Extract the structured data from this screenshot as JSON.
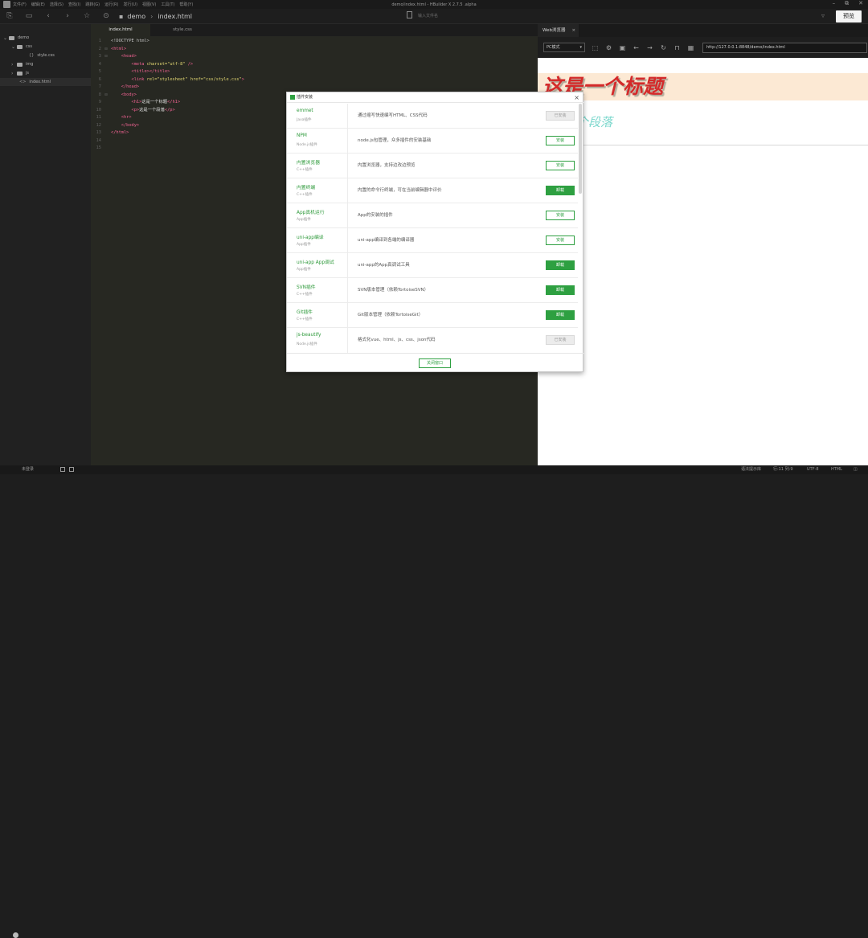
{
  "app": {
    "window_title": "demo/index.html - HBuilder X 2.7.5 .alpha",
    "menu": [
      "文件(F)",
      "编辑(E)",
      "选择(S)",
      "查找(I)",
      "跳转(G)",
      "运行(R)",
      "发行(U)",
      "视图(V)",
      "工具(T)",
      "帮助(Y)"
    ],
    "window_controls": [
      "–",
      "⧉",
      "✕"
    ]
  },
  "toolbar": {
    "breadcrumb": [
      "demo",
      "index.html"
    ],
    "search_placeholder": "输入文件名",
    "preview_label": "预览"
  },
  "sidebar": {
    "items": [
      {
        "label": "demo"
      },
      {
        "label": "css"
      },
      {
        "label": "style.css"
      },
      {
        "label": "img"
      },
      {
        "label": "js"
      },
      {
        "label": "index.html"
      }
    ]
  },
  "editor": {
    "tabs": [
      {
        "label": "index.html"
      },
      {
        "label": "style.css"
      }
    ],
    "line_numbers": [
      "1",
      "2",
      "3",
      "4",
      "5",
      "6",
      "7",
      "8",
      "9",
      "10",
      "11",
      "12",
      "13",
      "14",
      "15"
    ],
    "code": {
      "l1": "<!DOCTYPE html>",
      "l2a": "<html",
      "l2b": ">",
      "l3a": "<head",
      "l3b": ">",
      "l4a": "<meta",
      "l4b": " charset=",
      "l4c": "\"utf-8\"",
      "l4d": " />",
      "l5a": "<title></title>",
      "l6a": "<link",
      "l6b": " rel=",
      "l6c": "\"stylesheet\"",
      "l6d": " href=",
      "l6e": "\"css/style.css\"",
      "l6f": ">",
      "l7": "</head>",
      "l8": "<body>",
      "l9a": "<h1>",
      "l9b": "这是一个标题",
      "l9c": "</h1>",
      "l10a": "<p>",
      "l10b": "这是一个段落",
      "l10c": "</p>",
      "l11": "<hr>",
      "l12": "</body>",
      "l13": "</html>"
    }
  },
  "browser": {
    "tab_label": "Web浏览器",
    "device": "PC模式",
    "url": "http://127.0.0.1:8848/demo/index.html",
    "h1": "这是一个标题",
    "p": "个段落"
  },
  "dialog": {
    "title": "插件安装",
    "close_label": "关闭窗口",
    "plugins": [
      {
        "name": "emmet",
        "type": "Java插件",
        "desc": "通过缩写快速编写HTML、CSS代码",
        "action": "已安装"
      },
      {
        "name": "NPM",
        "type": "Node.js插件",
        "desc": "node.js包管理，众多插件的安装基础",
        "action": "安装"
      },
      {
        "name": "内置浏览器",
        "type": "C++插件",
        "desc": "内置浏览器，支持边改边预览",
        "action": "安装"
      },
      {
        "name": "内置终端",
        "type": "C++插件",
        "desc": "内置的命令行终端，可在当前编辑器中评价",
        "action": "卸载"
      },
      {
        "name": "App真机运行",
        "type": "App插件",
        "desc": "App的安装的插件",
        "action": "安装"
      },
      {
        "name": "uni-app编译",
        "type": "App插件",
        "desc": "uni-app编译到各端的编译器",
        "action": "安装"
      },
      {
        "name": "uni-app App调试",
        "type": "App插件",
        "desc": "uni-app的App真调试工具",
        "action": "卸载"
      },
      {
        "name": "SVN插件",
        "type": "C++插件",
        "desc": "SVN版本管理（依赖TortoiseSVN）",
        "action": "卸载"
      },
      {
        "name": "Git插件",
        "type": "C++插件",
        "desc": "Git版本管理（依赖TortoiseGit）",
        "action": "卸载"
      },
      {
        "name": "js-beautify",
        "type": "Node.js插件",
        "desc": "格式化vue、html、js、css、json代码",
        "action": "已安装"
      }
    ]
  },
  "statusbar": {
    "login": "未登录",
    "syntax": "语法提示库",
    "position": "行:11  列:9",
    "encoding": "UTF-8",
    "language": "HTML"
  },
  "colors": {
    "accent": "#2ea041",
    "tag": "#f06292",
    "string": "#e6db74",
    "h1": "#d42a2a"
  }
}
